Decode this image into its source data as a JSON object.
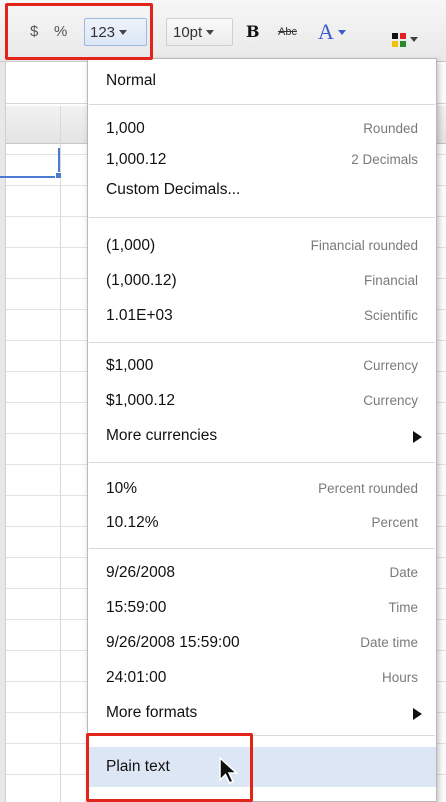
{
  "toolbar": {
    "currency_label": "$",
    "percent_label": "%",
    "number_format_label": "123",
    "font_size_label": "10pt",
    "bold_label": "B",
    "strikethrough_label": "Abc",
    "text_color_label": "A",
    "icons": {
      "bg_color": "background-color-icon"
    }
  },
  "menu": {
    "normal": {
      "label": "Normal"
    },
    "group_number": [
      {
        "label": "1,000",
        "hint": "Rounded"
      },
      {
        "label": "1,000.12",
        "hint": "2 Decimals"
      },
      {
        "label": "Custom Decimals...",
        "hint": ""
      }
    ],
    "group_financial": [
      {
        "label": "(1,000)",
        "hint": "Financial rounded"
      },
      {
        "label": "(1,000.12)",
        "hint": "Financial"
      },
      {
        "label": "1.01E+03",
        "hint": "Scientific"
      }
    ],
    "group_currency": [
      {
        "label": "$1,000",
        "hint": "Currency"
      },
      {
        "label": "$1,000.12",
        "hint": "Currency"
      },
      {
        "label": "More currencies",
        "hint": ""
      }
    ],
    "group_percent": [
      {
        "label": "10%",
        "hint": "Percent rounded"
      },
      {
        "label": "10.12%",
        "hint": "Percent"
      }
    ],
    "group_date": [
      {
        "label": "9/26/2008",
        "hint": "Date"
      },
      {
        "label": "15:59:00",
        "hint": "Time"
      },
      {
        "label": "9/26/2008 15:59:00",
        "hint": "Date time"
      },
      {
        "label": "24:01:00",
        "hint": "Hours"
      },
      {
        "label": "More formats",
        "hint": ""
      }
    ],
    "plain_text": {
      "label": "Plain text"
    }
  },
  "colors": {
    "highlight": "#e2231a",
    "hover_bg": "#dde6f4",
    "text_color_icon": "#3b5ccc",
    "selection": "#4a7bd1"
  }
}
